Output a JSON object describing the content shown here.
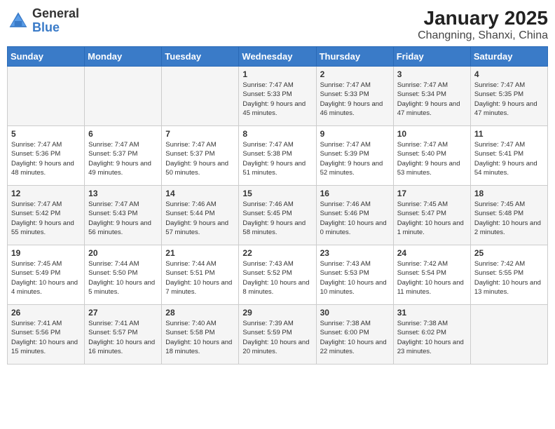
{
  "header": {
    "logo_general": "General",
    "logo_blue": "Blue",
    "title": "January 2025",
    "subtitle": "Changning, Shanxi, China"
  },
  "days_of_week": [
    "Sunday",
    "Monday",
    "Tuesday",
    "Wednesday",
    "Thursday",
    "Friday",
    "Saturday"
  ],
  "weeks": [
    [
      {
        "day": "",
        "info": ""
      },
      {
        "day": "",
        "info": ""
      },
      {
        "day": "",
        "info": ""
      },
      {
        "day": "1",
        "info": "Sunrise: 7:47 AM\nSunset: 5:33 PM\nDaylight: 9 hours and 45 minutes."
      },
      {
        "day": "2",
        "info": "Sunrise: 7:47 AM\nSunset: 5:33 PM\nDaylight: 9 hours and 46 minutes."
      },
      {
        "day": "3",
        "info": "Sunrise: 7:47 AM\nSunset: 5:34 PM\nDaylight: 9 hours and 47 minutes."
      },
      {
        "day": "4",
        "info": "Sunrise: 7:47 AM\nSunset: 5:35 PM\nDaylight: 9 hours and 47 minutes."
      }
    ],
    [
      {
        "day": "5",
        "info": "Sunrise: 7:47 AM\nSunset: 5:36 PM\nDaylight: 9 hours and 48 minutes."
      },
      {
        "day": "6",
        "info": "Sunrise: 7:47 AM\nSunset: 5:37 PM\nDaylight: 9 hours and 49 minutes."
      },
      {
        "day": "7",
        "info": "Sunrise: 7:47 AM\nSunset: 5:37 PM\nDaylight: 9 hours and 50 minutes."
      },
      {
        "day": "8",
        "info": "Sunrise: 7:47 AM\nSunset: 5:38 PM\nDaylight: 9 hours and 51 minutes."
      },
      {
        "day": "9",
        "info": "Sunrise: 7:47 AM\nSunset: 5:39 PM\nDaylight: 9 hours and 52 minutes."
      },
      {
        "day": "10",
        "info": "Sunrise: 7:47 AM\nSunset: 5:40 PM\nDaylight: 9 hours and 53 minutes."
      },
      {
        "day": "11",
        "info": "Sunrise: 7:47 AM\nSunset: 5:41 PM\nDaylight: 9 hours and 54 minutes."
      }
    ],
    [
      {
        "day": "12",
        "info": "Sunrise: 7:47 AM\nSunset: 5:42 PM\nDaylight: 9 hours and 55 minutes."
      },
      {
        "day": "13",
        "info": "Sunrise: 7:47 AM\nSunset: 5:43 PM\nDaylight: 9 hours and 56 minutes."
      },
      {
        "day": "14",
        "info": "Sunrise: 7:46 AM\nSunset: 5:44 PM\nDaylight: 9 hours and 57 minutes."
      },
      {
        "day": "15",
        "info": "Sunrise: 7:46 AM\nSunset: 5:45 PM\nDaylight: 9 hours and 58 minutes."
      },
      {
        "day": "16",
        "info": "Sunrise: 7:46 AM\nSunset: 5:46 PM\nDaylight: 10 hours and 0 minutes."
      },
      {
        "day": "17",
        "info": "Sunrise: 7:45 AM\nSunset: 5:47 PM\nDaylight: 10 hours and 1 minute."
      },
      {
        "day": "18",
        "info": "Sunrise: 7:45 AM\nSunset: 5:48 PM\nDaylight: 10 hours and 2 minutes."
      }
    ],
    [
      {
        "day": "19",
        "info": "Sunrise: 7:45 AM\nSunset: 5:49 PM\nDaylight: 10 hours and 4 minutes."
      },
      {
        "day": "20",
        "info": "Sunrise: 7:44 AM\nSunset: 5:50 PM\nDaylight: 10 hours and 5 minutes."
      },
      {
        "day": "21",
        "info": "Sunrise: 7:44 AM\nSunset: 5:51 PM\nDaylight: 10 hours and 7 minutes."
      },
      {
        "day": "22",
        "info": "Sunrise: 7:43 AM\nSunset: 5:52 PM\nDaylight: 10 hours and 8 minutes."
      },
      {
        "day": "23",
        "info": "Sunrise: 7:43 AM\nSunset: 5:53 PM\nDaylight: 10 hours and 10 minutes."
      },
      {
        "day": "24",
        "info": "Sunrise: 7:42 AM\nSunset: 5:54 PM\nDaylight: 10 hours and 11 minutes."
      },
      {
        "day": "25",
        "info": "Sunrise: 7:42 AM\nSunset: 5:55 PM\nDaylight: 10 hours and 13 minutes."
      }
    ],
    [
      {
        "day": "26",
        "info": "Sunrise: 7:41 AM\nSunset: 5:56 PM\nDaylight: 10 hours and 15 minutes."
      },
      {
        "day": "27",
        "info": "Sunrise: 7:41 AM\nSunset: 5:57 PM\nDaylight: 10 hours and 16 minutes."
      },
      {
        "day": "28",
        "info": "Sunrise: 7:40 AM\nSunset: 5:58 PM\nDaylight: 10 hours and 18 minutes."
      },
      {
        "day": "29",
        "info": "Sunrise: 7:39 AM\nSunset: 5:59 PM\nDaylight: 10 hours and 20 minutes."
      },
      {
        "day": "30",
        "info": "Sunrise: 7:38 AM\nSunset: 6:00 PM\nDaylight: 10 hours and 22 minutes."
      },
      {
        "day": "31",
        "info": "Sunrise: 7:38 AM\nSunset: 6:02 PM\nDaylight: 10 hours and 23 minutes."
      },
      {
        "day": "",
        "info": ""
      }
    ]
  ]
}
